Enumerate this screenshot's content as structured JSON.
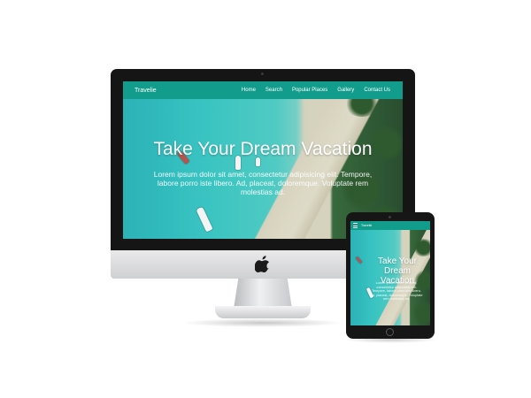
{
  "site": {
    "brand": "Travelie",
    "nav": [
      {
        "id": "home",
        "label": "Home"
      },
      {
        "id": "search",
        "label": "Search"
      },
      {
        "id": "popular-places",
        "label": "Popular Places"
      },
      {
        "id": "gallery",
        "label": "Gallery"
      },
      {
        "id": "contact-us",
        "label": "Contact Us"
      }
    ],
    "hero": {
      "title_desktop": "Take Your Dream Vacation",
      "title_tablet": "Take Your Dream Vacation",
      "text": "Lorem ipsum dolor sit amet, consectetur adipisicing elit. Tempore, labore porro iste libero. Ad, placeat, doloremque. Voluptate rem molestias ad."
    }
  },
  "colors": {
    "nav_bg": "#119c8c",
    "bezel": "#151515",
    "water": "#3fd0cd"
  },
  "icons": {
    "apple_logo": "apple-logo-icon",
    "menu": "hamburger-menu-icon"
  }
}
